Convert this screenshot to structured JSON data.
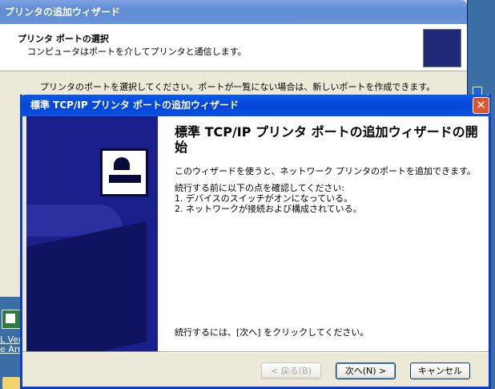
{
  "desktop": {
    "icon_label": "L Ver\ne Arra"
  },
  "background_wizard": {
    "title": "プリンタの追加ウィザード",
    "header_title": "プリンタ ポートの選択",
    "header_subtitle": "コンピュータはポートを介してプリンタと通信します。",
    "body_text": "プリンタのポートを選択してください。ポートが一覧にない場合は、新しいポートを作成できます。"
  },
  "wizard": {
    "title": "標準 TCP/IP プリンタ ポートの追加ウィザード",
    "heading": "標準 TCP/IP プリンタ ポートの追加ウィザードの開始",
    "intro": "このウィザードを使うと、ネットワーク プリンタのポートを追加できます。",
    "checklist_intro": "続行する前に以下の点を確認してください:",
    "checklist": [
      "1. デバイスのスイッチがオンになっている。",
      "2. ネットワークが接続および構成されている。"
    ],
    "continue_text": "続行するには、[次へ] をクリックしてください。",
    "close_symbol": "✕"
  },
  "buttons": {
    "back": "< 戻る(B)",
    "next": "次へ(N) >",
    "cancel": "キャンセル"
  },
  "colors": {
    "titlebar_active": "#0a52e0",
    "side_panel": "#1a1f8c",
    "close_button": "#e0532b"
  }
}
